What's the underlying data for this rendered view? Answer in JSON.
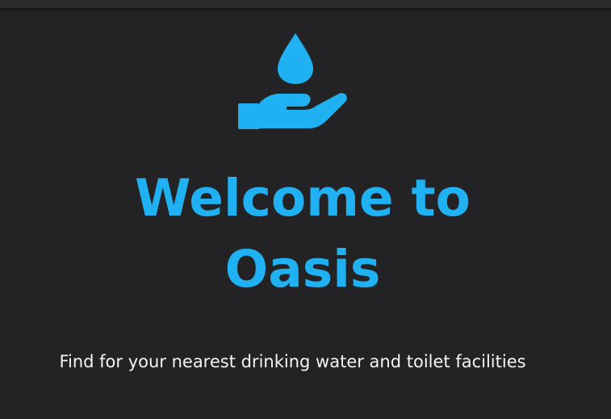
{
  "app": {
    "logo_icon": "hand-holding-water-drop-icon",
    "accent_color": "#1fb1f2",
    "background_color": "#232326"
  },
  "hero": {
    "title": "Welcome to Oasis",
    "subtitle": "Find for your nearest drinking water and toilet facilities"
  }
}
